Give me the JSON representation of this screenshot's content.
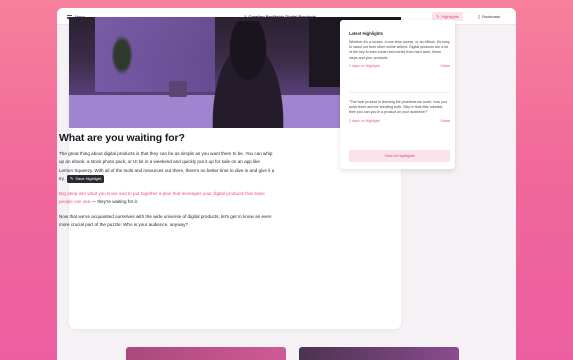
{
  "topbar": {
    "menu_label": "Menu",
    "doc_title": "2. Creating Profitable Digital Products",
    "highlights_label": "Highlights",
    "bookmarks_label": "Bookmark"
  },
  "article": {
    "heading": "What are you waiting for?",
    "para1": "The great thing about digital products is that they can be as simple as you want them to be. You can whip up an ebook, a stock photo pack, or UI kit in a weekend and quickly put it up for sale on an app like Lemon Squeezy. With all of the tools and resources out there, there's no better time to dive in and give it a try.",
    "save_highlight": "Save Highlight",
    "para2_highlight": "Dig deep into what you know and to put together a plan that leverages your digital products that solve people can use",
    "para2_rest": " — they're waiting for it.",
    "para3": "Now that we've acquainted ourselves with the wide universe of digital products, let's get to know an even more crucial part of the puzzle: Who is your audience, anyway?"
  },
  "popup": {
    "title": "Latest Highlights",
    "items": [
      {
        "quote": "Whether it's a course, a one-time course, or an eBook, it's easy to stand out from other online sellers. Digital products are a lot of the key to earn some real money from hard work, these steps and your products.",
        "meta_left": "2 days on Highlight",
        "meta_right": "Share"
      },
      {
        "quote": "\"The best product is learning the problems we solve, how you solve them and for bundling both. Step in that little mindset, then you can you in a product on your audience?\"",
        "meta_left": "2 days on Highlight",
        "meta_right": "Share"
      }
    ],
    "view_all": "View all highlights"
  },
  "colors": {
    "accent": "#ec4f78",
    "accent_bg": "#fbe3ea",
    "hero_purple": "#7455a3"
  }
}
